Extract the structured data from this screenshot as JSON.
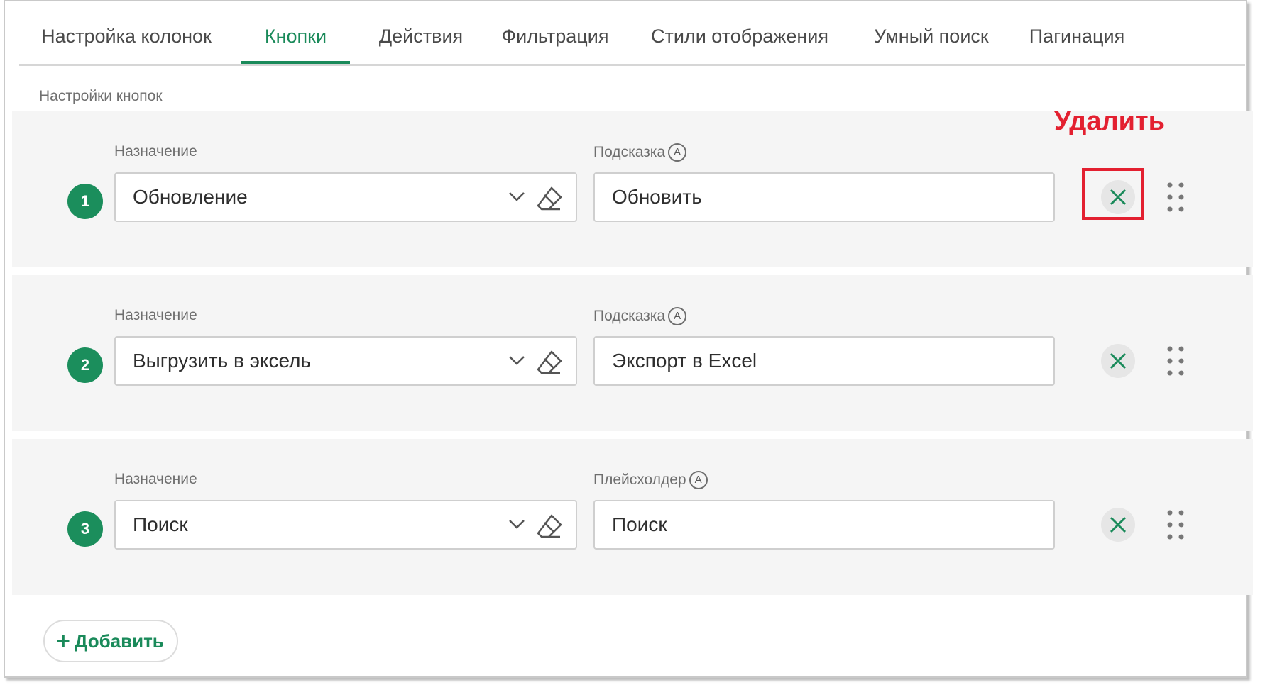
{
  "tabs": [
    {
      "label": "Настройка колонок"
    },
    {
      "label": "Кнопки"
    },
    {
      "label": "Действия"
    },
    {
      "label": "Фильтрация"
    },
    {
      "label": "Стили отображения"
    },
    {
      "label": "Умный поиск"
    },
    {
      "label": "Пагинация"
    }
  ],
  "active_tab": "Кнопки",
  "section_title": "Настройки кнопок",
  "annotation": {
    "label": "Удалить",
    "color": "#e32030"
  },
  "rows": [
    {
      "number": "1",
      "purpose_label": "Назначение",
      "purpose_value": "Обновление",
      "hint_label": "Подсказка",
      "hint_value": "Обновить"
    },
    {
      "number": "2",
      "purpose_label": "Назначение",
      "purpose_value": "Выгрузить в эксель",
      "hint_label": "Подсказка",
      "hint_value": "Экспорт в Excel"
    },
    {
      "number": "3",
      "purpose_label": "Назначение",
      "purpose_value": "Поиск",
      "hint_label": "Плейсхолдер",
      "hint_value": "Поиск"
    }
  ],
  "info_glyph": "A",
  "add_button": {
    "plus": "+",
    "label": "Добавить"
  },
  "colors": {
    "accent": "#1a8a5a",
    "badge": "#1b8e5c",
    "row_bg": "#f5f5f5",
    "annotation": "#e32030"
  },
  "icons": [
    "chevron-down-icon",
    "eraser-icon",
    "close-icon",
    "drag-handle-icon",
    "plus-icon"
  ]
}
